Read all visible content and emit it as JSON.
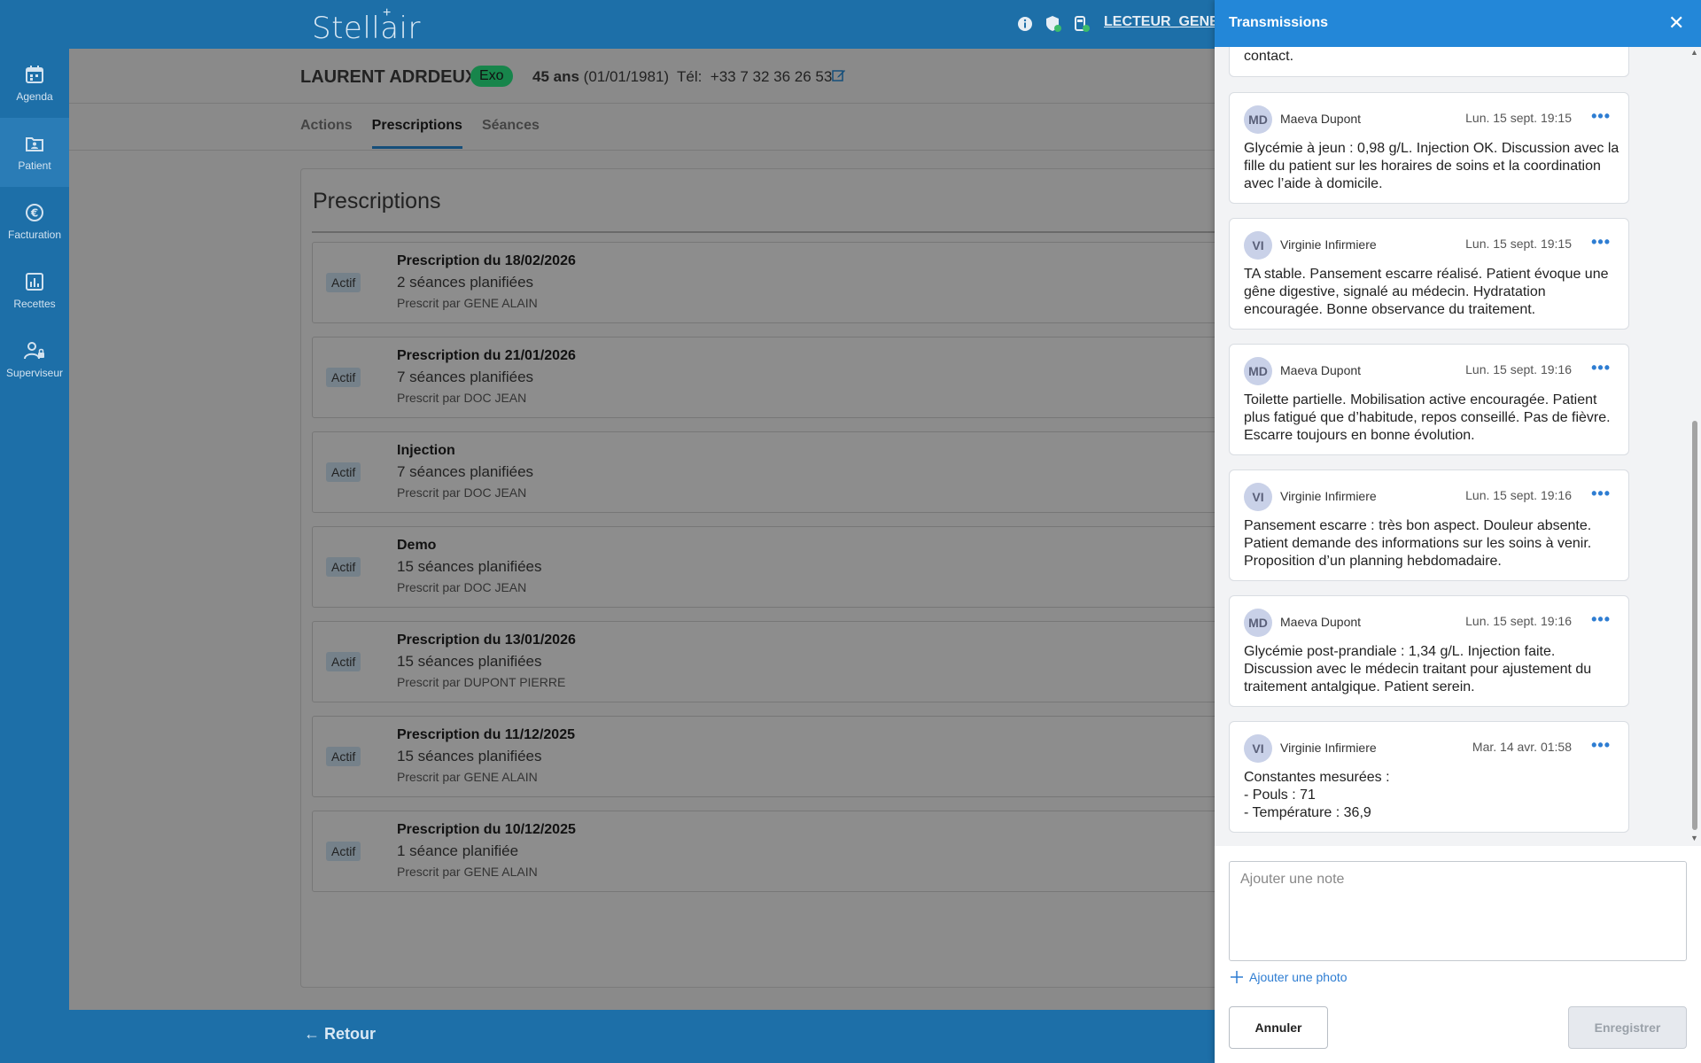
{
  "app": {
    "logo": "Stellair",
    "user": "LECTEUR_GENE"
  },
  "sidebar": {
    "items": [
      {
        "label": "Agenda",
        "icon": "calendar-icon"
      },
      {
        "label": "Patient",
        "icon": "patient-icon",
        "active": true
      },
      {
        "label": "Facturation",
        "icon": "euro-icon"
      },
      {
        "label": "Recettes",
        "icon": "chart-icon"
      },
      {
        "label": "Superviseur",
        "icon": "supervisor-icon"
      }
    ]
  },
  "patient": {
    "name": "LAURENT ADRDEUX",
    "badge": "Exo",
    "age": "45 ans",
    "birth": "(01/01/1981)",
    "tel_label": "Tél:",
    "tel": "+33 7 32 36 26 53"
  },
  "tabs": [
    {
      "label": "Actions"
    },
    {
      "label": "Prescriptions",
      "active": true
    },
    {
      "label": "Séances"
    }
  ],
  "prescriptions": {
    "title": "Prescriptions",
    "items": [
      {
        "status": "Actif",
        "name": "Prescription du 18/02/2026",
        "sessions": "2 séances planifiées",
        "prescriber": "Prescrit par GENE ALAIN"
      },
      {
        "status": "Actif",
        "name": "Prescription du 21/01/2026",
        "sessions": "7 séances planifiées",
        "prescriber": "Prescrit par DOC JEAN"
      },
      {
        "status": "Actif",
        "name": "Injection",
        "sessions": "7 séances planifiées",
        "prescriber": "Prescrit par DOC JEAN"
      },
      {
        "status": "Actif",
        "name": "Demo",
        "sessions": "15 séances planifiées",
        "prescriber": "Prescrit par DOC JEAN"
      },
      {
        "status": "Actif",
        "name": "Prescription du 13/01/2026",
        "sessions": "15 séances planifiées",
        "prescriber": "Prescrit par DUPONT PIERRE"
      },
      {
        "status": "Actif",
        "name": "Prescription du 11/12/2025",
        "sessions": "15 séances planifiées",
        "prescriber": "Prescrit par GENE ALAIN"
      },
      {
        "status": "Actif",
        "name": "Prescription du 10/12/2025",
        "sessions": "1 séance planifiée",
        "prescriber": "Prescrit par GENE ALAIN"
      }
    ]
  },
  "footer": {
    "back": "Retour"
  },
  "panel": {
    "title": "Transmissions",
    "partial_note_text": "contact.",
    "notes": [
      {
        "initials": "MD",
        "author": "Maeva Dupont",
        "date": "Lun. 15 sept. 19:15",
        "text": "Glycémie à jeun : 0,98 g/L. Injection OK. Discussion avec la fille du patient sur les horaires de soins et la coordination avec l’aide à domicile."
      },
      {
        "initials": "VI",
        "author": "Virginie Infirmiere",
        "date": "Lun. 15 sept. 19:15",
        "text": "TA stable. Pansement escarre réalisé. Patient évoque une gêne digestive, signalé au médecin. Hydratation encouragée. Bonne observance du traitement."
      },
      {
        "initials": "MD",
        "author": "Maeva Dupont",
        "date": "Lun. 15 sept. 19:16",
        "text": "Toilette partielle. Mobilisation active encouragée. Patient plus fatigué que d’habitude, repos conseillé. Pas de fièvre. Escarre toujours en bonne évolution."
      },
      {
        "initials": "VI",
        "author": "Virginie Infirmiere",
        "date": "Lun. 15 sept. 19:16",
        "text": "Pansement escarre : très bon aspect. Douleur absente. Patient demande des informations sur les soins à venir. Proposition d’un planning hebdomadaire."
      },
      {
        "initials": "MD",
        "author": "Maeva Dupont",
        "date": "Lun. 15 sept. 19:16",
        "text": "Glycémie post-prandiale : 1,34 g/L. Injection faite. Discussion avec le médecin traitant pour ajustement du traitement antalgique. Patient serein."
      },
      {
        "initials": "VI",
        "author": "Virginie Infirmiere",
        "date": "Mar. 14 avr. 01:58",
        "text": "Constantes mesurées :\n- Pouls : 71\n- Température : 36,9"
      }
    ],
    "input_placeholder": "Ajouter une note",
    "add_photo": "Ajouter une photo",
    "cancel": "Annuler",
    "save": "Enregistrer"
  }
}
